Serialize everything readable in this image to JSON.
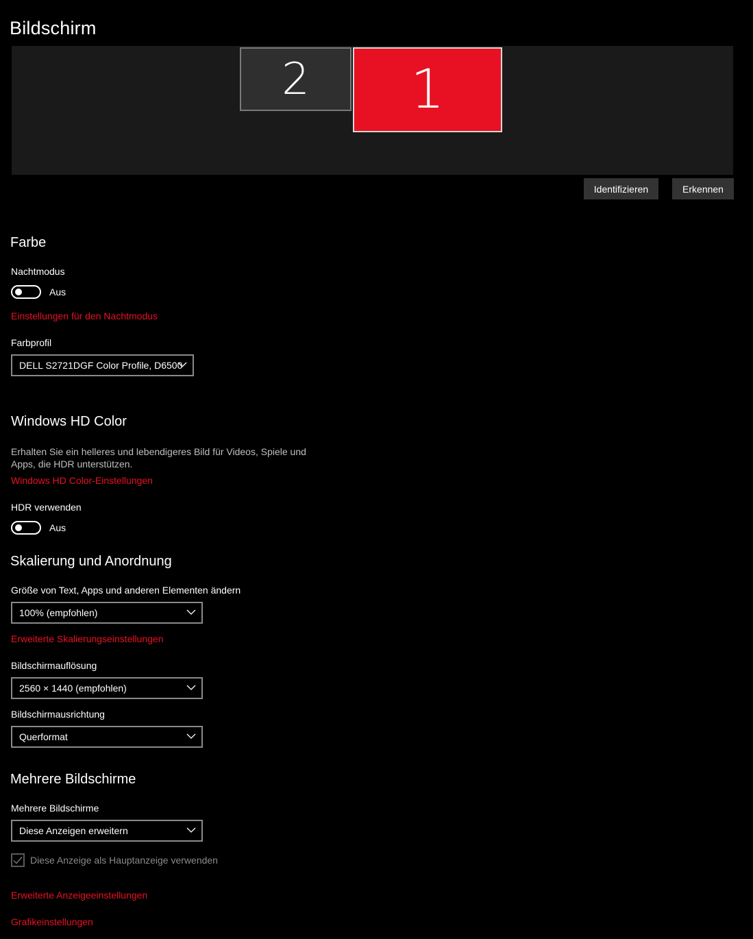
{
  "page": {
    "title": "Bildschirm"
  },
  "arrangement": {
    "monitors": [
      {
        "number": "2",
        "selected": false
      },
      {
        "number": "1",
        "selected": true
      }
    ],
    "identify_label": "Identifizieren",
    "detect_label": "Erkennen"
  },
  "color": {
    "section_title": "Farbe",
    "night_mode_label": "Nachtmodus",
    "night_mode_state": "Aus",
    "night_mode_settings_link": "Einstellungen für den Nachtmodus",
    "profile_label": "Farbprofil",
    "profile_value": "DELL S2721DGF Color Profile, D6500"
  },
  "hdcolor": {
    "section_title": "Windows HD Color",
    "description": "Erhalten Sie ein helleres und lebendigeres Bild für Videos, Spiele und Apps, die HDR unterstützen.",
    "settings_link": "Windows HD Color-Einstellungen",
    "hdr_label": "HDR verwenden",
    "hdr_state": "Aus"
  },
  "scale": {
    "section_title": "Skalierung und Anordnung",
    "size_label": "Größe von Text, Apps und anderen Elementen ändern",
    "size_value": "100% (empfohlen)",
    "advanced_link": "Erweiterte Skalierungseinstellungen",
    "resolution_label": "Bildschirmauflösung",
    "resolution_value": "2560 × 1440 (empfohlen)",
    "orientation_label": "Bildschirmausrichtung",
    "orientation_value": "Querformat"
  },
  "multi": {
    "section_title": "Mehrere Bildschirme",
    "label": "Mehrere Bildschirme",
    "value": "Diese Anzeigen erweitern",
    "main_display_label": "Diese Anzeige als Hauptanzeige verwenden",
    "main_display_checked": true
  },
  "footer_links": {
    "advanced_display": "Erweiterte Anzeigeeinstellungen",
    "graphics": "Grafikeinstellungen"
  },
  "colors": {
    "accent": "#e81123",
    "background": "#000000",
    "arrangement_bg": "#1a1a1a",
    "button_bg": "#333333"
  }
}
